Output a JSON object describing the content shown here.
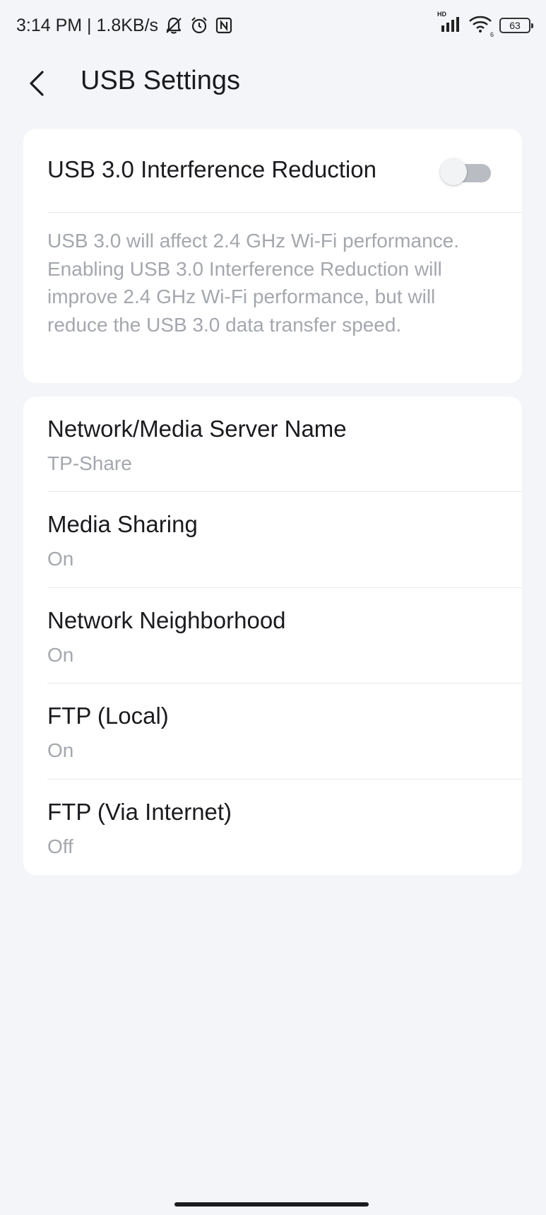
{
  "status_bar": {
    "time_speed": "3:14 PM | 1.8KB/s",
    "network_badge": "HD",
    "wifi_badge": "6",
    "battery_level": "63",
    "icons": [
      "bell-off-icon",
      "alarm-icon",
      "nfc-icon",
      "signal-icon",
      "wifi-icon",
      "battery-icon"
    ]
  },
  "header": {
    "title": "USB Settings",
    "back_icon": "chevron-left-icon"
  },
  "usb_card": {
    "toggle_label": "USB 3.0 Interference Reduction",
    "toggle_on": false,
    "description": "USB 3.0 will affect 2.4 GHz Wi-Fi performance. Enabling USB 3.0 Interference Reduction will improve 2.4 GHz Wi-Fi performance, but will reduce the USB 3.0 data transfer speed."
  },
  "share_card": {
    "items": [
      {
        "title": "Network/Media Server Name",
        "value": "TP-Share"
      },
      {
        "title": "Media Sharing",
        "value": "On"
      },
      {
        "title": "Network Neighborhood",
        "value": "On"
      },
      {
        "title": "FTP (Local)",
        "value": "On"
      },
      {
        "title": "FTP (Via Internet)",
        "value": "Off"
      }
    ]
  },
  "colors": {
    "background": "#F3F5F9",
    "card": "#FFFFFF",
    "primary_text": "#1B1B1F",
    "secondary_text": "#A4A7AD",
    "toggle_track_off": "#B9BCC3"
  }
}
